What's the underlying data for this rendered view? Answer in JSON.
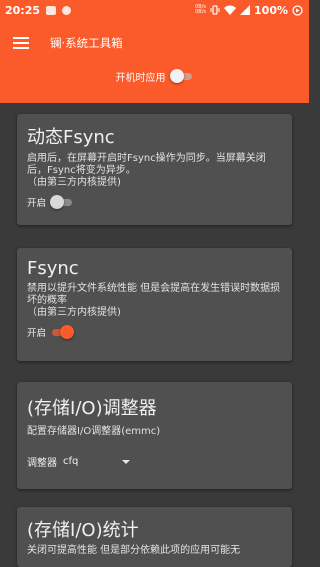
{
  "status_bar": {
    "time": "20:25",
    "net_rate_top": "0B/s",
    "net_rate_bottom": "0B/s",
    "battery": "100%"
  },
  "toolbar": {
    "title": "镧·系统工具箱",
    "boot_apply_label": "开机时应用",
    "boot_apply_on": false
  },
  "cards": [
    {
      "title": "动态Fsync",
      "description": "启用后，在屏幕开启时Fsync操作为同步。当屏幕关闭后，Fsync将变为异步。\n（由第三方内核提供)",
      "toggle_label": "开启",
      "toggle_on": false
    },
    {
      "title": "Fsync",
      "description": "禁用以提升文件系统性能 但是会提高在发生错误时数据损坏的概率\n（由第三方内核提供)",
      "toggle_label": "开启",
      "toggle_on": true
    },
    {
      "title": "(存储I/O)调整器",
      "description": "配置存储器I/O调整器(emmc)",
      "select_label": "调整器",
      "select_value": "cfq"
    },
    {
      "title": "(存储I/O)统计",
      "description": "关闭可提高性能 但是部分依赖此项的应用可能无"
    }
  ],
  "colors": {
    "accent": "#fb5a2a",
    "background": "#3a3a3a",
    "card": "#505050"
  }
}
